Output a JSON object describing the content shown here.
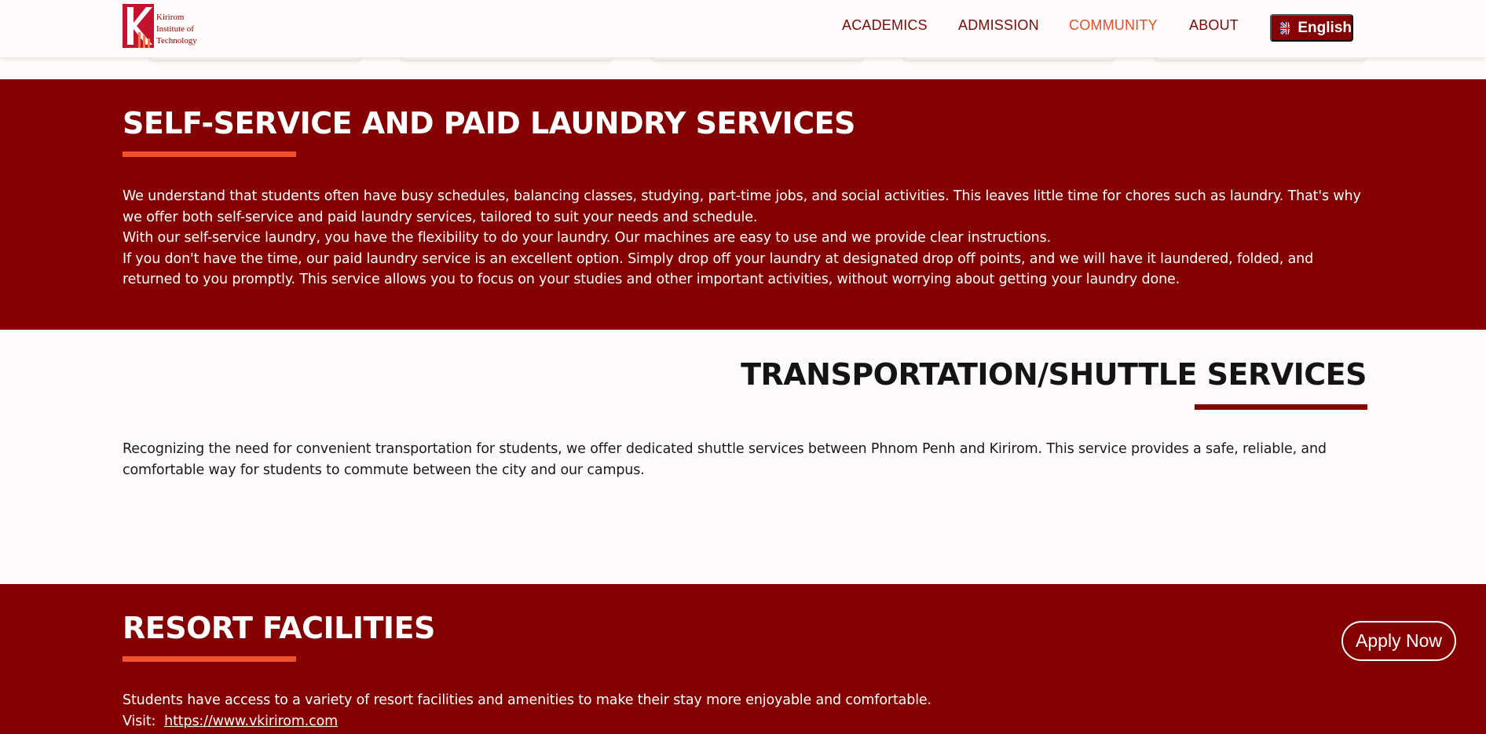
{
  "brand": {
    "logo_lines": [
      "Kirirom",
      "Institute of",
      "Technology"
    ],
    "accent": "#850000",
    "highlight": "#e2502a"
  },
  "nav": {
    "items": [
      {
        "label": "ACADEMICS",
        "active": false
      },
      {
        "label": "ADMISSION",
        "active": false
      },
      {
        "label": "COMMUNITY",
        "active": true
      },
      {
        "label": "ABOUT",
        "active": false
      }
    ],
    "language": {
      "label": "English",
      "icon": "uk-flag-icon"
    }
  },
  "laundry": {
    "title": "SELF-SERVICE AND PAID LAUNDRY SERVICES",
    "paragraphs": [
      "We understand that students often have busy schedules, balancing classes, studying, part-time jobs, and social activities. This leaves little time for chores such as laundry. That's why we offer both self-service and paid laundry services, tailored to suit your needs and schedule.",
      "With our self-service laundry, you have the flexibility to do your laundry. Our machines are easy to use and we provide clear instructions.",
      "If you don't have the time, our paid laundry service is an excellent option. Simply drop off your laundry at designated drop off points, and we will have it laundered, folded, and returned to you promptly. This service allows you to focus on your studies and other important activities, without worrying about getting your laundry done."
    ]
  },
  "transport": {
    "title": "TRANSPORTATION/SHUTTLE SERVICES",
    "paragraph": "Recognizing the need for convenient transportation for students, we offer dedicated shuttle services between Phnom Penh and Kirirom. This service provides a safe, reliable, and comfortable way for students to commute between the city and our campus."
  },
  "resort": {
    "title": "RESORT FACILITIES",
    "paragraph": "Students have access to a variety of resort facilities and amenities to make their stay more enjoyable and comfortable.",
    "visit_label": "Visit:",
    "visit_link": "https://www.vkirirom.com"
  },
  "apply_button": "Apply Now"
}
